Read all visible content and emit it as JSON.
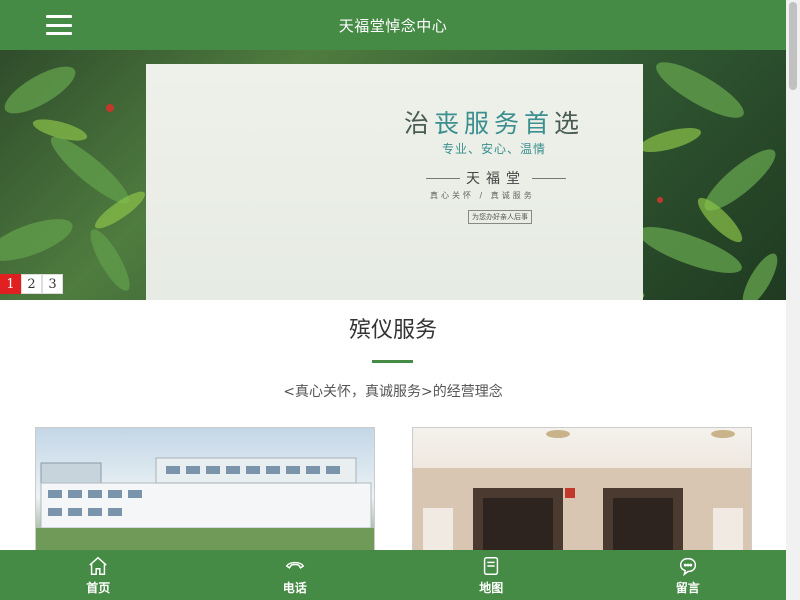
{
  "header": {
    "title": "天福堂悼念中心",
    "menu_icon": "hamburger-menu-icon"
  },
  "banner": {
    "headline_main": "治",
    "headline_highlight": "丧服务首",
    "headline_end": "选",
    "subtitle": "专业、安心、温情",
    "brand": "天福堂",
    "motto": "真心关怀 / 真诚服务",
    "tag": "为您办好亲人后事",
    "pages": [
      "1",
      "2",
      "3"
    ],
    "active_page": "1"
  },
  "section": {
    "title": "殡仪服务",
    "description": "<真心关怀，真诚服务>的经营理念",
    "accent_color": "#458a45"
  },
  "bottom_nav": [
    {
      "label": "首页",
      "icon": "home-icon"
    },
    {
      "label": "电话",
      "icon": "phone-icon"
    },
    {
      "label": "地图",
      "icon": "map-book-icon"
    },
    {
      "label": "留言",
      "icon": "chat-bubble-icon"
    }
  ],
  "colors": {
    "brand_green": "#458a45",
    "active_dot": "#e02020"
  }
}
